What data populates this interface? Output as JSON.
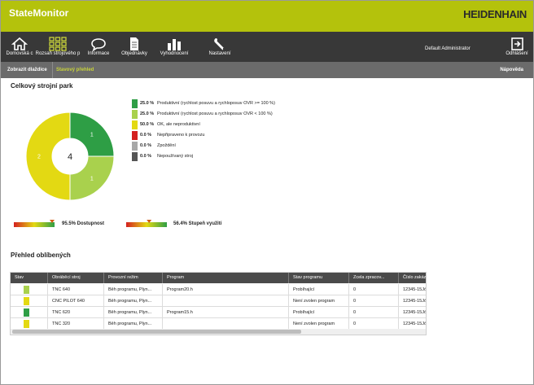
{
  "app": {
    "title": "StateMonitor",
    "brand": "HEIDENHAIN"
  },
  "nav": {
    "items": [
      {
        "label": "Domovská c",
        "icon": "home-icon"
      },
      {
        "label": "Rozsah strojového p",
        "icon": "grid-icon"
      },
      {
        "label": "Informace",
        "icon": "chat-bubble-icon"
      },
      {
        "label": "Objednávky",
        "icon": "document-icon"
      },
      {
        "label": "Vyhodnocení",
        "icon": "bar-chart-icon"
      },
      {
        "label": "Nastavení",
        "icon": "wrench-icon"
      }
    ],
    "user": "Default Administrator",
    "logout": "Odhlášení"
  },
  "subnav": {
    "tab1": "Zobrazit dlaždice",
    "tab2": "Stavový přehled",
    "help": "Nápověda"
  },
  "park": {
    "title": "Celkový strojní park",
    "center_count": "4",
    "legend": [
      {
        "pct": "25.0 %",
        "text": "Produktivní (rychlost posuvu a rychloposuv OVR >= 100 %)",
        "color": "#2e9e45"
      },
      {
        "pct": "25.0 %",
        "text": "Produktivní (rychlost posuvu a rychloposuv OVR < 100 %)",
        "color": "#a9d14d"
      },
      {
        "pct": "50.0 %",
        "text": "OK, ale neproduktivní",
        "color": "#e3d913"
      },
      {
        "pct": "0.0 %",
        "text": "Nepřipraveno k provozu",
        "color": "#d42020"
      },
      {
        "pct": "0.0 %",
        "text": "Zpoždění",
        "color": "#a8a8a8"
      },
      {
        "pct": "0.0 %",
        "text": "Nepoužívaný stroj",
        "color": "#555555"
      }
    ],
    "segment_labels": [
      "1",
      "1",
      "2"
    ],
    "gauges": [
      {
        "label": "95.5% Dostupnost",
        "value": 95.5
      },
      {
        "label": "56.4% Stupeň využití",
        "value": 56.4
      }
    ]
  },
  "favorites": {
    "title": "Přehled oblíbených",
    "columns": [
      "Stav",
      "Obráběcí stroj",
      "Provozní režim",
      "Program",
      "Stav programu",
      "Zcela zpracov...",
      "Číslo zakázk"
    ],
    "rows": [
      {
        "status_color": "#a9d14d",
        "machine": "TNC 640",
        "mode": "Běh programu, Plyn...",
        "program": "Program20.h",
        "program_state": "Probíhající",
        "done": "0",
        "order": "12345-15Jól"
      },
      {
        "status_color": "#e3d913",
        "machine": "CNC PILOT 640",
        "mode": "Běh programu, Plyn...",
        "program": "",
        "program_state": "Není zvolen program",
        "done": "0",
        "order": "12345-15Jól"
      },
      {
        "status_color": "#2e9e45",
        "machine": "TNC 620",
        "mode": "Běh programu, Plyn...",
        "program": "Program15.h",
        "program_state": "Probíhající",
        "done": "0",
        "order": "12345-15Jól"
      },
      {
        "status_color": "#e3d913",
        "machine": "TNC 320",
        "mode": "Běh programu, Plyn...",
        "program": "",
        "program_state": "Není zvolen program",
        "done": "0",
        "order": "12345-15Jól"
      }
    ]
  },
  "chart_data": {
    "type": "pie",
    "categories": [
      "Produktivní (OVR >= 100 %)",
      "Produktivní (OVR < 100 %)",
      "OK, ale neproduktivní",
      "Nepřipraveno k provozu",
      "Zpoždění",
      "Nepoužívaný stroj"
    ],
    "values": [
      1,
      1,
      2,
      0,
      0,
      0
    ],
    "colors": [
      "#2e9e45",
      "#a9d14d",
      "#e3d913",
      "#d42020",
      "#a8a8a8",
      "#555555"
    ],
    "total": 4
  }
}
